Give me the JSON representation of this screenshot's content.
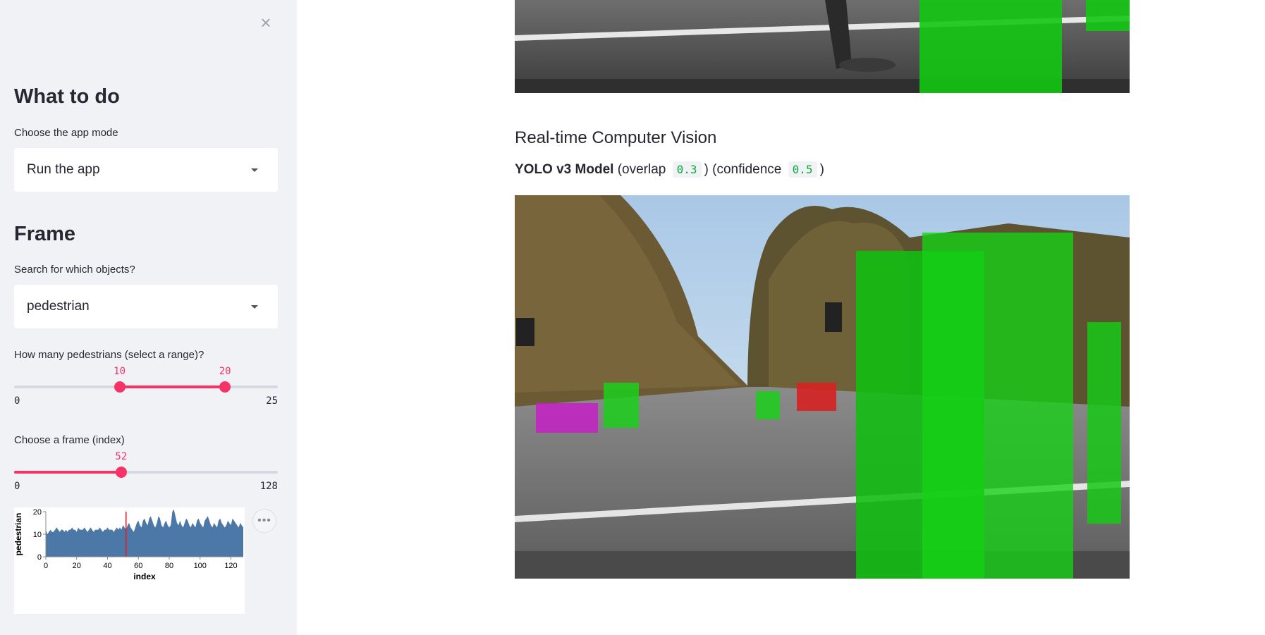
{
  "sidebar": {
    "close_glyph": "×",
    "mode_heading": "What to do",
    "mode_label": "Choose the app mode",
    "mode_value": "Run the app",
    "frame_heading": "Frame",
    "objects_label": "Search for which objects?",
    "objects_value": "pedestrian",
    "range_slider": {
      "label": "How many pedestrians (select a range)?",
      "low": "10",
      "high": "20",
      "min": "0",
      "max": "25"
    },
    "frame_slider": {
      "label": "Choose a frame (index)",
      "value": "52",
      "min": "0",
      "max": "128"
    },
    "chart_menu_glyph": "•••"
  },
  "chart_data": {
    "type": "area",
    "xlabel": "index",
    "ylabel": "pedestrian",
    "xlim": [
      0,
      128
    ],
    "ylim": [
      0,
      20
    ],
    "x_ticks": [
      "0",
      "20",
      "40",
      "60",
      "80",
      "100",
      "120"
    ],
    "y_ticks": [
      "0",
      "10",
      "20"
    ],
    "marker_x": 52,
    "color": "#4c78a8",
    "marker_color": "#e4181c",
    "values": [
      12,
      10,
      11,
      12,
      11,
      11,
      12,
      13,
      12,
      11,
      12,
      12,
      11,
      12,
      11,
      12,
      12,
      13,
      12,
      12,
      11,
      13,
      12,
      12,
      12,
      13,
      12,
      11,
      12,
      13,
      12,
      11,
      12,
      12,
      12,
      13,
      12,
      11,
      12,
      12,
      13,
      12,
      12,
      12,
      11,
      12,
      13,
      12,
      13,
      12,
      14,
      13,
      12,
      14,
      15,
      13,
      12,
      11,
      13,
      15,
      16,
      14,
      13,
      16,
      17,
      15,
      14,
      17,
      18,
      16,
      14,
      13,
      15,
      18,
      17,
      14,
      13,
      15,
      16,
      14,
      13,
      14,
      20,
      21,
      18,
      15,
      14,
      16,
      14,
      13,
      15,
      17,
      16,
      14,
      13,
      15,
      14,
      13,
      16,
      17,
      15,
      14,
      13,
      16,
      17,
      18,
      16,
      14,
      13,
      15,
      14,
      13,
      16,
      17,
      15,
      14,
      13,
      14,
      16,
      15,
      14,
      17,
      16,
      15,
      14,
      13,
      15,
      14,
      13
    ]
  },
  "main": {
    "title": "Real-time Computer Vision",
    "caption_bold": "YOLO v3 Model",
    "caption_overlap_pre": " (overlap ",
    "overlap": "0.3",
    "caption_conf_pre": ") (confidence ",
    "confidence": "0.5",
    "caption_end": ")"
  }
}
